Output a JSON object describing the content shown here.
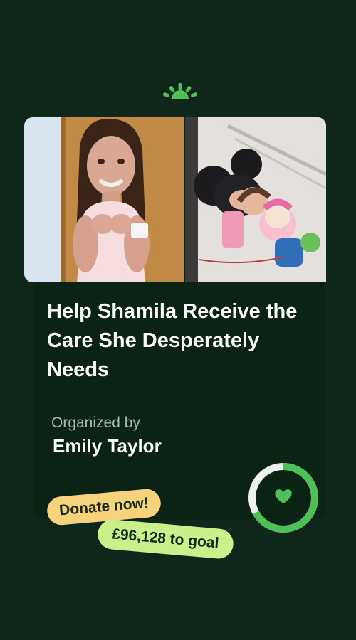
{
  "campaign": {
    "title": "Help Shamila Receive the Care She Desperately Needs",
    "organizer_label": "Organized by",
    "organizer_name": "Emily Taylor"
  },
  "actions": {
    "donate_label": "Donate now!",
    "goal_text": "£96,128 to goal"
  },
  "progress": {
    "fraction": 0.67
  },
  "icons": {
    "logo": "sunrise-logo-icon",
    "heart": "heart-icon"
  },
  "colors": {
    "background": "#0f261a",
    "card": "#0a2315",
    "accent_green": "#4fbf58",
    "donate_yellow": "#f6d27a",
    "goal_lime": "#c9f08a"
  }
}
